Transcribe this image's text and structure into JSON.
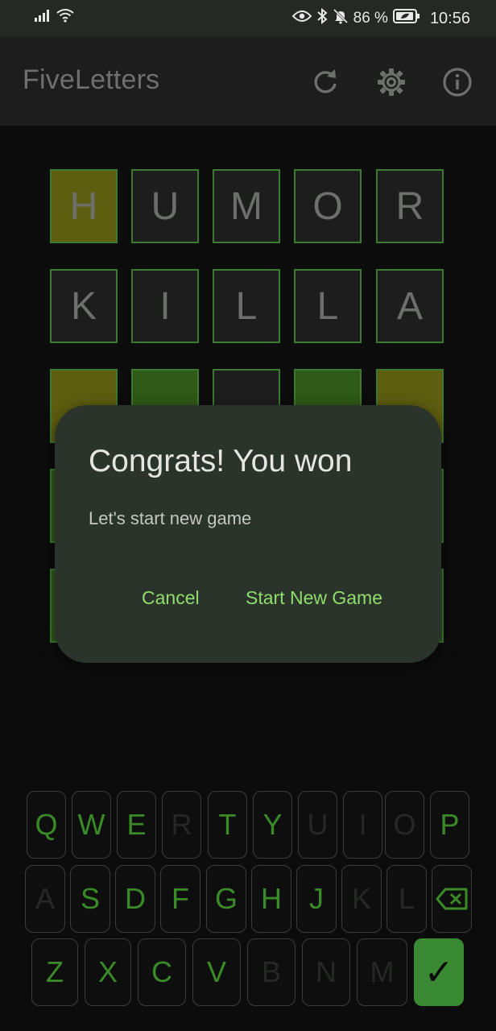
{
  "status_bar": {
    "battery_percent": "86 %",
    "time": "10:56"
  },
  "app_bar": {
    "title": "FiveLetters",
    "icons": [
      "refresh-icon",
      "settings-gear-icon",
      "info-icon"
    ]
  },
  "board": {
    "rows": [
      [
        {
          "letter": "H",
          "state": "present"
        },
        {
          "letter": "U",
          "state": "absent"
        },
        {
          "letter": "M",
          "state": "absent"
        },
        {
          "letter": "O",
          "state": "absent"
        },
        {
          "letter": "R",
          "state": "absent"
        }
      ],
      [
        {
          "letter": "K",
          "state": "absent"
        },
        {
          "letter": "I",
          "state": "absent"
        },
        {
          "letter": "L",
          "state": "absent"
        },
        {
          "letter": "L",
          "state": "absent"
        },
        {
          "letter": "A",
          "state": "absent"
        }
      ],
      [
        {
          "letter": "",
          "state": "present"
        },
        {
          "letter": "",
          "state": "correct"
        },
        {
          "letter": "",
          "state": "absent"
        },
        {
          "letter": "",
          "state": "correct"
        },
        {
          "letter": "",
          "state": "present"
        }
      ]
    ]
  },
  "dialog": {
    "title": "Congrats! You won",
    "message": "Let's start new game",
    "cancel_label": "Cancel",
    "confirm_label": "Start New Game"
  },
  "keyboard": {
    "row1": [
      "Q",
      "W",
      "E",
      "R",
      "T",
      "Y",
      "U",
      "I",
      "O",
      "P"
    ],
    "row2": [
      "A",
      "S",
      "D",
      "F",
      "G",
      "H",
      "J",
      "K",
      "L"
    ],
    "row3": [
      "Z",
      "X",
      "C",
      "V",
      "B",
      "N",
      "M"
    ],
    "dimmed": [
      "R",
      "U",
      "I",
      "O",
      "A",
      "K",
      "L",
      "B",
      "N",
      "M"
    ],
    "backspace_icon": "backspace-icon",
    "enter_label": "✓"
  },
  "colors": {
    "accent_green": "#8fdd6c",
    "tile_border": "#3b7a30",
    "tile_present": "#5e5e10",
    "tile_correct": "#2f5a17"
  }
}
